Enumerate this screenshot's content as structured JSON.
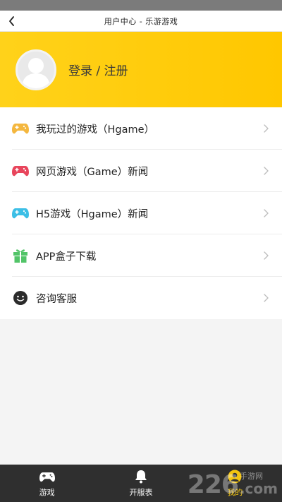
{
  "header": {
    "title": "用户中心 - 乐游游戏",
    "login_label": "登录 / 注册"
  },
  "menu": {
    "items": [
      {
        "label": "我玩过的游戏（Hgame）",
        "icon": "gamepad-icon",
        "color": "#f4b73f"
      },
      {
        "label": "网页游戏（Game）新闻",
        "icon": "gamepad-icon",
        "color": "#e8455c"
      },
      {
        "label": "H5游戏（Hgame）新闻",
        "icon": "gamepad-icon",
        "color": "#3cbfe6"
      },
      {
        "label": "APP盒子下载",
        "icon": "gift-icon",
        "color": "#52c468"
      },
      {
        "label": "咨询客服",
        "icon": "service-face-icon",
        "color": "#2b2b2b"
      }
    ]
  },
  "bottom_nav": {
    "items": [
      {
        "label": "游戏",
        "icon": "gamepad-icon",
        "active": false
      },
      {
        "label": "开服表",
        "icon": "bell-icon",
        "active": false
      },
      {
        "label": "我的",
        "icon": "user-icon",
        "active": true
      }
    ]
  },
  "watermark": {
    "number": "226",
    "top": "手游网",
    "bottom": ".com"
  },
  "colors": {
    "header_gradient_start": "#ffd21a",
    "header_gradient_end": "#ffc700",
    "nav_background": "#2f2f2f",
    "active_tab": "#f3c410"
  }
}
